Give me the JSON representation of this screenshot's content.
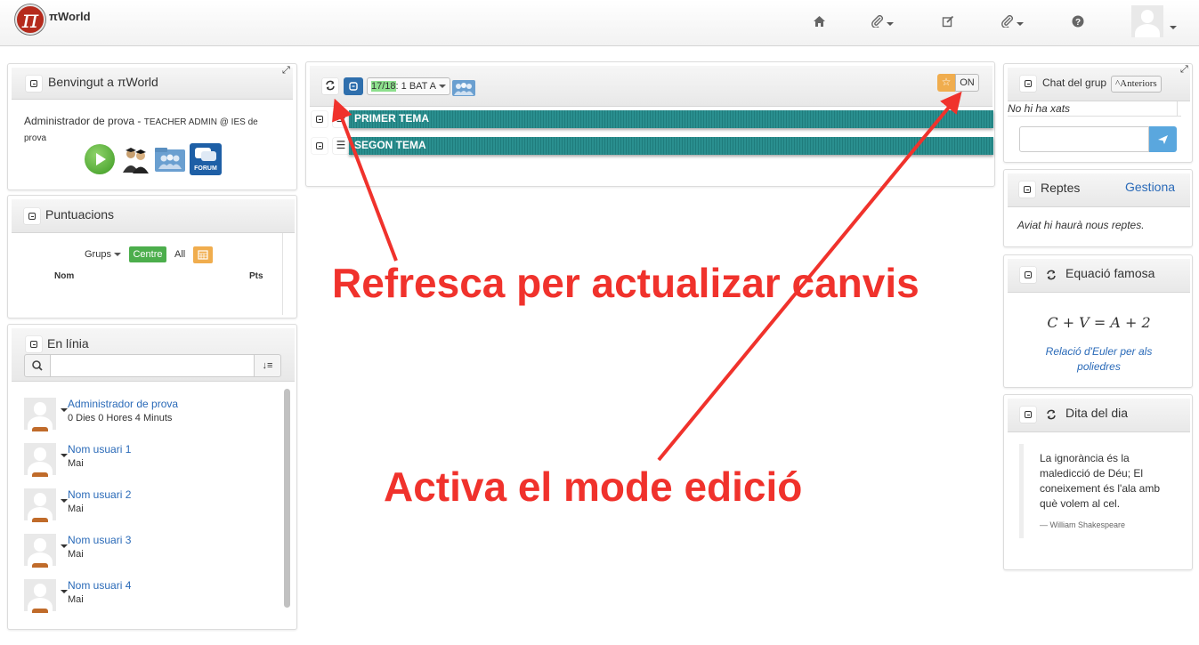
{
  "navbar": {
    "logo_glyph": "π",
    "brand": "πWorld",
    "icons": [
      "home-icon",
      "paperclip-icon",
      "edit-icon",
      "paperclip-icon",
      "help-icon"
    ]
  },
  "welcome": {
    "title": "Benvingut a πWorld",
    "user_name": "Administrador de prova - ",
    "user_role": "TEACHER ADMIN @ IES de prova",
    "apps": [
      "play-icon",
      "graduates-icon",
      "group-folder-icon",
      "forum-icon"
    ],
    "forum_label": "FORUM"
  },
  "scores": {
    "title": "Puntuacions",
    "groups_label": "Grups",
    "centre_button": "Centre",
    "all_label": "All",
    "col_name": "Nom",
    "col_points": "Pts"
  },
  "online": {
    "title": "En línia",
    "search_placeholder": "",
    "users": [
      {
        "name": "Administrador de prova",
        "status": "0 Dies 0 Hores 4 Minuts"
      },
      {
        "name": "Nom usuari 1",
        "status": "Mai"
      },
      {
        "name": "Nom usuari 2",
        "status": "Mai"
      },
      {
        "name": "Nom usuari 3",
        "status": "Mai"
      },
      {
        "name": "Nom usuari 4",
        "status": "Mai"
      }
    ]
  },
  "main": {
    "course_year": "17/18",
    "course_group": ": 1 BAT A",
    "edit_toggle": "ON",
    "themes": [
      "PRIMER TEMA",
      "SEGON TEMA"
    ]
  },
  "chat": {
    "title": "Chat del grup",
    "older_button": "Anteriors",
    "empty_text": "No hi ha xats",
    "input_value": ""
  },
  "challenges": {
    "title": "Reptes",
    "manage_link": "Gestiona",
    "message": "Aviat hi haurà nous reptes."
  },
  "equation": {
    "title": "Equació famosa",
    "formula": "C + V = A + 2",
    "caption": "Relació d'Euler per als poliedres"
  },
  "quote": {
    "title": "Dita del dia",
    "text": "La ignorància és la maledicció de Déu; El coneixement és l'ala amb què volem al cel.",
    "author": "— William Shakespeare"
  },
  "annotations": {
    "refresh": "Refresca per actualizar canvis",
    "edit_mode": "Activa el mode edició",
    "color": "#f0322c"
  }
}
